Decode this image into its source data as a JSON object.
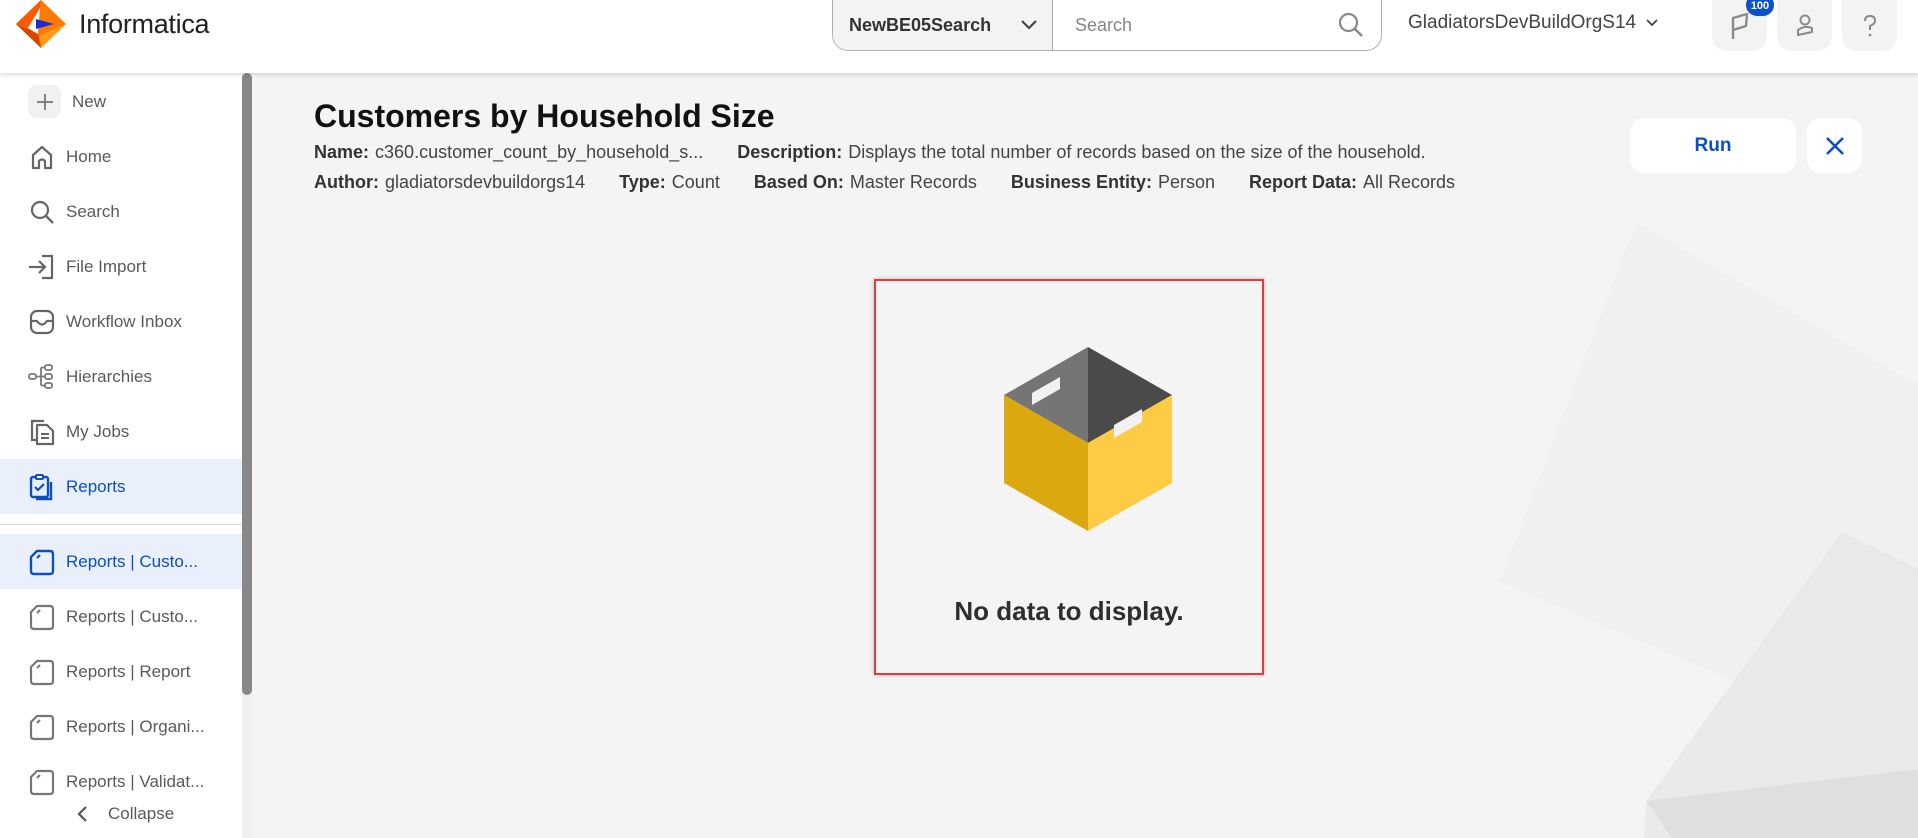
{
  "header": {
    "brand": "Informatica",
    "search_scope": "NewBE05Search",
    "search_placeholder": "Search",
    "search_value": "",
    "org_name": "GladiatorsDevBuildOrgS14",
    "notification_count": "100",
    "icons": [
      "flag-icon",
      "user-icon",
      "help-icon"
    ]
  },
  "sidebar": {
    "new_label": "New",
    "items": [
      {
        "label": "Home",
        "icon": "home-icon",
        "active": false
      },
      {
        "label": "Search",
        "icon": "search-icon",
        "active": false
      },
      {
        "label": "File Import",
        "icon": "file-import-icon",
        "active": false
      },
      {
        "label": "Workflow Inbox",
        "icon": "inbox-icon",
        "active": false
      },
      {
        "label": "Hierarchies",
        "icon": "hierarchy-icon",
        "active": false
      },
      {
        "label": "My Jobs",
        "icon": "jobs-icon",
        "active": false
      },
      {
        "label": "Reports",
        "icon": "reports-icon",
        "active": true
      }
    ],
    "recent": [
      {
        "label": "Reports | Custo...",
        "active": true
      },
      {
        "label": "Reports | Custo...",
        "active": false
      },
      {
        "label": "Reports | Report",
        "active": false
      },
      {
        "label": "Reports | Organi...",
        "active": false
      },
      {
        "label": "Reports | Validat...",
        "active": false
      }
    ],
    "collapse_label": "Collapse"
  },
  "report": {
    "title": "Customers by Household Size",
    "name_label": "Name:",
    "name_value": "c360.customer_count_by_household_s...",
    "description_label": "Description:",
    "description_value": "Displays the total number of records based on the size of the household.",
    "author_label": "Author:",
    "author_value": "gladiatorsdevbuildorgs14",
    "type_label": "Type:",
    "type_value": "Count",
    "based_on_label": "Based On:",
    "based_on_value": "Master Records",
    "entity_label": "Business Entity:",
    "entity_value": "Person",
    "report_data_label": "Report Data:",
    "report_data_value": "All Records",
    "run_label": "Run",
    "empty_message": "No data to display."
  },
  "colors": {
    "accent": "#0b4fc1",
    "active_bg": "#e9f0fb",
    "badge": "#0b52c9",
    "highlight_border": "#e6393e",
    "box_left": "#dba90f",
    "box_right": "#fdcc44",
    "box_inner_left": "#757575",
    "box_inner_right": "#4a4a4a"
  }
}
